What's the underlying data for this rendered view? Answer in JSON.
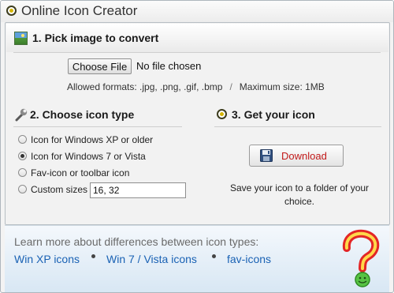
{
  "window": {
    "title": "Online Icon Creator"
  },
  "step1": {
    "heading": "1. Pick image to convert",
    "choose_file_label": "Choose File",
    "no_file_text": "No file chosen",
    "allowed_formats": "Allowed formats: .jpg, .png, .gif, .bmp",
    "separator": "/",
    "max_size": "Maximum size: 1MB"
  },
  "step2": {
    "heading": "2. Choose icon type",
    "options": [
      {
        "label": "Icon for Windows XP or older",
        "checked": false
      },
      {
        "label": "Icon for Windows 7 or Vista",
        "checked": true
      },
      {
        "label": "Fav-icon or toolbar icon",
        "checked": false
      },
      {
        "label": "Custom sizes",
        "checked": false
      }
    ],
    "custom_sizes_value": "16, 32"
  },
  "step3": {
    "heading": "3. Get your icon",
    "download_label": "Download",
    "save_note": "Save your icon to a folder of your choice."
  },
  "footer": {
    "learn_more": "Learn more about differences between icon types:",
    "links": [
      "Win XP icons",
      "Win 7 / Vista icons",
      "fav-icons"
    ]
  },
  "colors": {
    "link": "#1a62b4",
    "download_text": "#c21a1a",
    "footer_gradient_end": "#d8e7f4"
  },
  "icons": {
    "app": "app-logo-icon",
    "step1": "image-icon",
    "step2": "wrench-icon",
    "step3": "app-logo-icon",
    "download": "floppy-disk-icon",
    "mascot": "question-mark-mascot-icon"
  }
}
